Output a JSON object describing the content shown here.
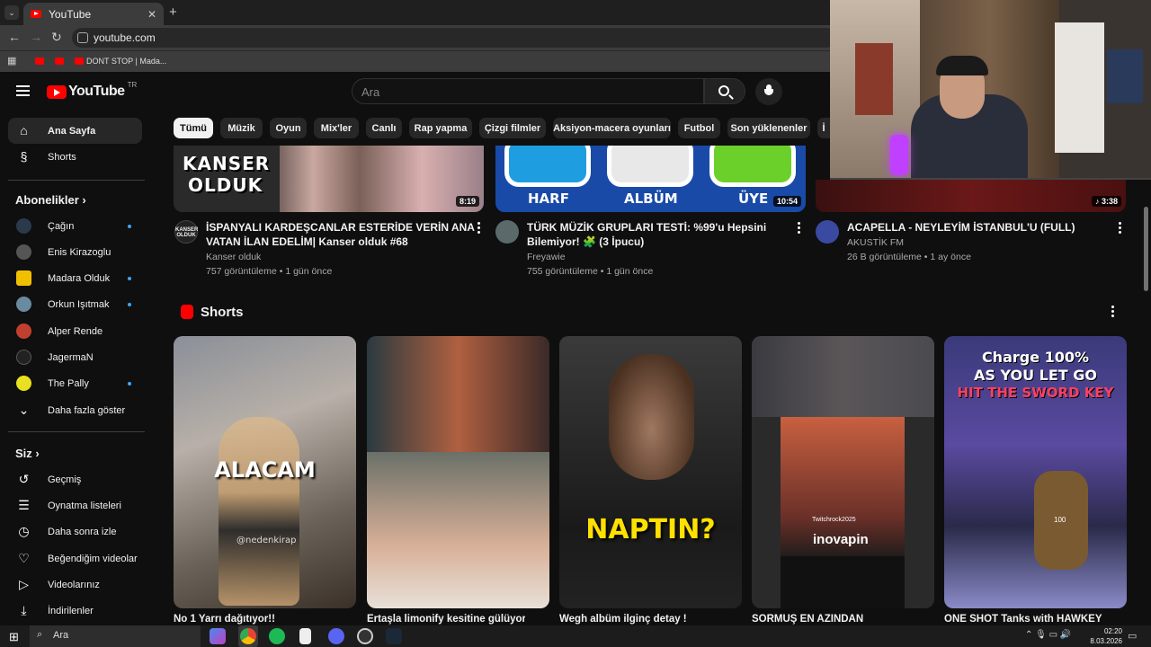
{
  "browser": {
    "tab_title": "YouTube",
    "url": "youtube.com",
    "bookmark_label": "DONT STOP | Mada..."
  },
  "header": {
    "logo_text": "YouTube",
    "country_code": "TR",
    "search_placeholder": "Ara"
  },
  "sidebar": {
    "main": [
      {
        "label": "Ana Sayfa",
        "icon": "home-icon",
        "active": true
      },
      {
        "label": "Shorts",
        "icon": "shorts-icon"
      }
    ],
    "subscriptions_heading": "Abonelikler",
    "subscriptions": [
      {
        "label": "Çağın",
        "live": true,
        "color": "#2a3a4a"
      },
      {
        "label": "Enis Kirazoglu",
        "live": false,
        "color": "#555555"
      },
      {
        "label": "Madara Olduk",
        "live": true,
        "color": "#f0c000"
      },
      {
        "label": "Orkun Işıtmak",
        "live": true,
        "color": "#6a8aa0"
      },
      {
        "label": "Alper Rende",
        "live": false,
        "color": "#c04030"
      },
      {
        "label": "JagermaN",
        "live": false,
        "color": "#222222"
      },
      {
        "label": "The Pally",
        "live": true,
        "color": "#e8e020"
      }
    ],
    "show_more": "Daha fazla göster",
    "you_heading": "Siz",
    "you_items": [
      {
        "label": "Geçmiş",
        "icon": "history-icon"
      },
      {
        "label": "Oynatma listeleri",
        "icon": "playlists-icon"
      },
      {
        "label": "Daha sonra izle",
        "icon": "watch-later-icon"
      },
      {
        "label": "Beğendiğim videolar",
        "icon": "liked-videos-icon"
      },
      {
        "label": "Videolarınız",
        "icon": "your-videos-icon"
      },
      {
        "label": "İndirilenler",
        "icon": "downloads-icon"
      }
    ]
  },
  "chips": [
    "Tümü",
    "Müzik",
    "Oyun",
    "Mix'ler",
    "Canlı",
    "Rap yapma",
    "Çizgi filmler",
    "Aksiyon-macera oyunları",
    "Futbol",
    "Son yüklenenler",
    "İ"
  ],
  "videos": [
    {
      "title_line1": "İSPANYALI KARDEŞCANLAR ESTERİDE VERİN ANA",
      "title_line2": "VATAN İLAN EDELİM| Kanser olduk #68",
      "channel": "Kanser olduk",
      "meta": "757 görüntüleme • 1 gün önce",
      "duration": "8:19",
      "thumb_text_1": "KANSER",
      "thumb_text_2": "OLDUK",
      "avatar_text": "KANSER OLDUK"
    },
    {
      "title_line1": "TÜRK MÜZİK GRUPLARI TESTİ: %99'u Hepsini",
      "title_line2": "Bilemiyor! 🧩 (3 İpucu)",
      "channel": "Freyawie",
      "meta": "755 görüntüleme • 1 gün önce",
      "duration": "10:54",
      "thumb_labels": [
        "HARF",
        "ALBÜM",
        "ÜYE"
      ]
    },
    {
      "title_line1": "ACAPELLA - NEYLEYİM İSTANBUL'U (FULL)",
      "title_line2": "",
      "channel": "AKUSTİK FM",
      "meta": "26 B görüntüleme • 1 ay önce",
      "duration": "3:38"
    }
  ],
  "shorts": {
    "heading": "Shorts",
    "items": [
      {
        "title": "No 1 Yarrı dağıtıyor!!",
        "caption": "ALACAM",
        "watermark": "@nedenkirap"
      },
      {
        "title": "Ertaşla limonify kesitine gülüyor",
        "caption": ""
      },
      {
        "title": "Wegh albüm ilginç detay !",
        "caption": "NAPTIN?"
      },
      {
        "title": "SORMUŞ EN AZINDAN",
        "caption": "inovapin",
        "overlay_name": "Twitchrock2025"
      },
      {
        "title": "ONE SHOT Tanks with HAWKEYE",
        "caption_1": "Charge 100%",
        "caption_2": "AS YOU LET GO",
        "caption_3": "HIT THE SWORD KEY",
        "game_number": "100"
      }
    ]
  },
  "taskbar": {
    "search_text": "Ara",
    "time": "02:20",
    "date": "8.03.2026"
  },
  "colors": {
    "background": "#0f0f0f",
    "chip": "#272727",
    "accent_red": "#ff0000",
    "live_dot": "#3ea6ff"
  }
}
